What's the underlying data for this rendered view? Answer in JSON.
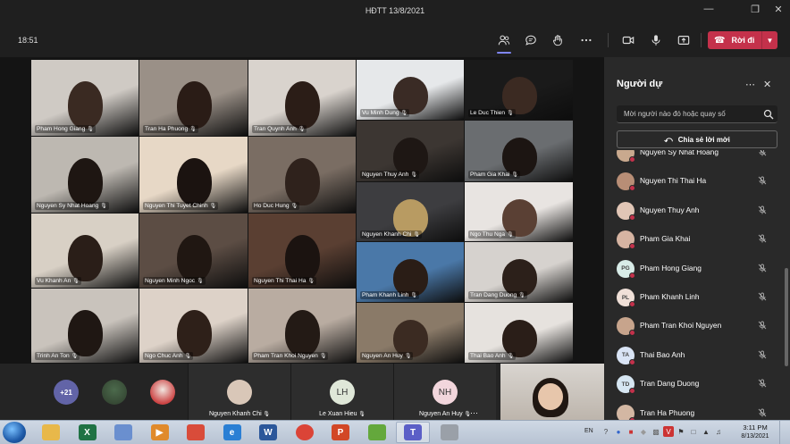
{
  "window": {
    "title": "HĐTT 13/8/2021"
  },
  "toolbar": {
    "time": "18:51",
    "leave_label": "Rời đi",
    "buttons": [
      {
        "name": "participants-icon",
        "active": true
      },
      {
        "name": "chat-icon",
        "active": false
      },
      {
        "name": "reactions-icon",
        "active": false
      },
      {
        "name": "more-actions-icon",
        "active": false
      },
      {
        "name": "camera-icon",
        "active": false
      },
      {
        "name": "microphone-icon",
        "active": false
      },
      {
        "name": "share-screen-icon",
        "active": false
      }
    ]
  },
  "grid": {
    "tiles": [
      {
        "name": "Pham Hong Giang",
        "bg": "#cfcac4",
        "skin": "#3a2a22"
      },
      {
        "name": "Tran Ha Phuong",
        "bg": "#9a9087",
        "skin": "#2a1c16"
      },
      {
        "name": "Tran Quynh Anh",
        "bg": "#d9d3cd",
        "skin": "#2b1d17"
      },
      {
        "name": "Vu Minh Dung",
        "bg": "#e6e8ea",
        "skin": "#3a2b25"
      },
      {
        "name": "Le Duc Thien",
        "bg": "#1a1a1a",
        "skin": "#3b2a22"
      },
      {
        "name": "Nguyen Sy Nhat Hoang",
        "bg": "#bdb8b1",
        "skin": "#1e1612"
      },
      {
        "name": "Nguyen Thi Tuyet Chinh",
        "bg": "#e7d8c6",
        "skin": "#1b1310"
      },
      {
        "name": "Ho Duc Hung",
        "bg": "#7a6d63",
        "skin": "#2f221c"
      },
      {
        "name": "Nguyen Thuy Anh",
        "bg": "#3c3632",
        "skin": "#1e1714"
      },
      {
        "name": "Pham Gia Khai",
        "bg": "#6a6d70",
        "skin": "#1c1512"
      },
      {
        "name": "Vu Khanh An",
        "bg": "#d8d0c5",
        "skin": "#2a1e18"
      },
      {
        "name": "Nguyen Minh Ngoc",
        "bg": "#5c4d44",
        "skin": "#201712"
      },
      {
        "name": "Nguyen Thi Thai Ha",
        "bg": "#5a3f32",
        "skin": "#1b1310"
      },
      {
        "name": "Nguyen Khanh Chi",
        "bg": "#3d3d40",
        "skin": "#b89b62"
      },
      {
        "name": "Ngo Thu Nga",
        "bg": "#e8e4e1",
        "skin": "#5a4034"
      },
      {
        "name": "Trinh An Ton",
        "bg": "#c9c3bc",
        "skin": "#1f1713"
      },
      {
        "name": "Ngo Chuc Anh",
        "bg": "#ddd2c8",
        "skin": "#2e2019"
      },
      {
        "name": "Pham Tran Khoi Nguyen",
        "bg": "#b9aca1",
        "skin": "#231a15"
      },
      {
        "name": "Pham Khanh Linh",
        "bg": "#4a78a8",
        "skin": "#2a1d16"
      },
      {
        "name": "Tran Dang Duong",
        "bg": "#d6d2ce",
        "skin": "#2c201a"
      },
      {
        "name": "Nguyen An Huy",
        "bg": "#8a7a68",
        "skin": "#3b2b22"
      },
      {
        "name": "Thai Bao Anh",
        "bg": "#e6e2de",
        "skin": "#2a1e18"
      }
    ]
  },
  "strip": {
    "overflow_count": "+21",
    "tiles": [
      {
        "name": "Nguyen Khanh Chi",
        "initials": "",
        "color": "#d9c7b8"
      },
      {
        "name": "Le Xuan Hieu",
        "initials": "LH",
        "color": "#dfe7d8"
      },
      {
        "name": "Nguyen An Huy",
        "initials": "NH",
        "color": "#f2d6dc"
      }
    ]
  },
  "panel": {
    "title": "Người dự",
    "invite_placeholder": "Mời người nào đó hoặc quay số",
    "share_label": "Chia sẻ lời mời",
    "participants": [
      {
        "name": "Nguyen Sy Nhat Hoang",
        "initials": "",
        "color": "#c9a98e"
      },
      {
        "name": "Nguyen Thi Thai Ha",
        "initials": "",
        "color": "#b88e76"
      },
      {
        "name": "Nguyen Thuy Anh",
        "initials": "",
        "color": "#e1c6b6"
      },
      {
        "name": "Pham Gia Khai",
        "initials": "",
        "color": "#d6b4a2"
      },
      {
        "name": "Pham Hong Giang",
        "initials": "PG",
        "color": "#d8ece8"
      },
      {
        "name": "Pham Khanh Linh",
        "initials": "PL",
        "color": "#f0e0d8"
      },
      {
        "name": "Pham Tran Khoi Nguyen",
        "initials": "",
        "color": "#c7a48c"
      },
      {
        "name": "Thai Bao Anh",
        "initials": "TA",
        "color": "#d9e4f5"
      },
      {
        "name": "Tran Dang Duong",
        "initials": "TD",
        "color": "#d6e6f2"
      },
      {
        "name": "Tran Ha Phuong",
        "initials": "",
        "color": "#d3b7a3"
      }
    ]
  },
  "taskbar": {
    "apps": [
      {
        "name": "file-explorer",
        "label": "",
        "color": "#e8b84a"
      },
      {
        "name": "excel",
        "label": "X",
        "color": "#1f7244"
      },
      {
        "name": "paint",
        "label": "",
        "color": "#6a8fcf"
      },
      {
        "name": "media-player",
        "label": "▶",
        "color": "#e08a2b"
      },
      {
        "name": "snipping",
        "label": "",
        "color": "#d94c3a"
      },
      {
        "name": "internet-explorer",
        "label": "e",
        "color": "#2a7fd4"
      },
      {
        "name": "word",
        "label": "W",
        "color": "#2b579a"
      },
      {
        "name": "chrome",
        "label": "",
        "color": "#db4437"
      },
      {
        "name": "powerpoint",
        "label": "P",
        "color": "#d24726"
      },
      {
        "name": "evernote",
        "label": "",
        "color": "#64a83c"
      },
      {
        "name": "teams",
        "label": "T",
        "color": "#5b5fc7"
      },
      {
        "name": "tool",
        "label": "",
        "color": "#9aa0a8"
      }
    ],
    "lang": "EN",
    "time": "3:11 PM",
    "date": "8/13/2021"
  }
}
